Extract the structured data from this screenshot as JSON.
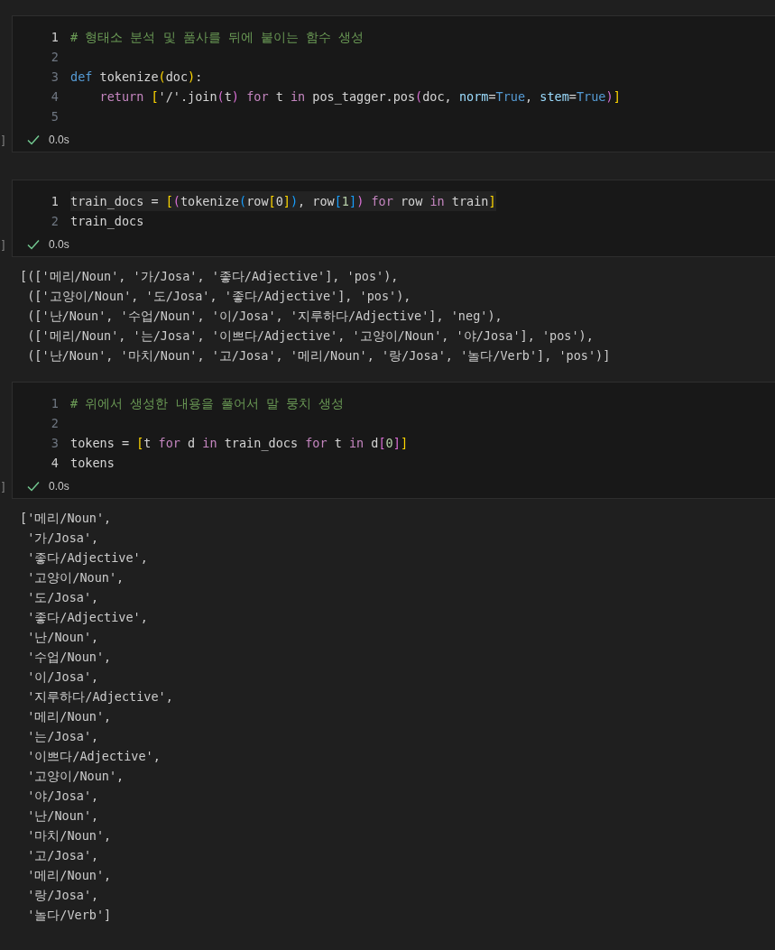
{
  "cells": [
    {
      "focused": false,
      "lines": [
        {
          "number": "1",
          "selected": true,
          "tokens": [
            {
              "kind": "comment",
              "text": "# 형태소 분석 및 품사를 뒤에 붙이는 함수 생성"
            }
          ]
        },
        {
          "number": "2",
          "selected": false
        },
        {
          "number": "3",
          "selected": false,
          "tokens": [
            {
              "kind": "keyword",
              "text": "def"
            },
            {
              "kind": "plain",
              "text": " tokenize"
            },
            {
              "kind": "b1",
              "text": "("
            },
            {
              "kind": "plain",
              "text": "doc"
            },
            {
              "kind": "b1",
              "text": ")"
            },
            {
              "kind": "plain",
              "text": ":"
            }
          ]
        },
        {
          "number": "4",
          "selected": false,
          "tokens": [
            {
              "kind": "control",
              "text": "    return "
            },
            {
              "kind": "b1",
              "text": "["
            },
            {
              "kind": "plain",
              "text": "'/'.join"
            },
            {
              "kind": "b2",
              "text": "("
            },
            {
              "kind": "plain",
              "text": "t"
            },
            {
              "kind": "b2",
              "text": ")"
            },
            {
              "kind": "control",
              "text": " for"
            },
            {
              "kind": "plain",
              "text": " t "
            },
            {
              "kind": "control",
              "text": "in"
            },
            {
              "kind": "plain",
              "text": " pos_tagger.pos"
            },
            {
              "kind": "b2",
              "text": "("
            },
            {
              "kind": "plain",
              "text": "doc, "
            },
            {
              "kind": "param",
              "text": "norm"
            },
            {
              "kind": "plain",
              "text": "="
            },
            {
              "kind": "keyword",
              "text": "True"
            },
            {
              "kind": "plain",
              "text": ", "
            },
            {
              "kind": "param",
              "text": "stem"
            },
            {
              "kind": "plain",
              "text": "="
            },
            {
              "kind": "keyword",
              "text": "True"
            },
            {
              "kind": "b2",
              "text": ")"
            },
            {
              "kind": "b1",
              "text": "]"
            }
          ]
        },
        {
          "number": "5",
          "selected": false
        }
      ],
      "status": {
        "bracket": "]",
        "time": "0.0s"
      }
    },
    {
      "focused": true,
      "lines": [
        {
          "number": "1",
          "selected": true,
          "tokens": [
            {
              "kind": "plain",
              "text": "train_docs = "
            },
            {
              "kind": "b1",
              "text": "["
            },
            {
              "kind": "b2",
              "text": "("
            },
            {
              "kind": "plain",
              "text": "tokenize"
            },
            {
              "kind": "b3",
              "text": "("
            },
            {
              "kind": "plain",
              "text": "row"
            },
            {
              "kind": "b1",
              "text": "["
            },
            {
              "kind": "plain",
              "text": "0"
            },
            {
              "kind": "b1",
              "text": "]"
            },
            {
              "kind": "b3",
              "text": ")"
            },
            {
              "kind": "plain",
              "text": ", row"
            },
            {
              "kind": "b3",
              "text": "["
            },
            {
              "kind": "number",
              "text": "1"
            },
            {
              "kind": "b3",
              "text": "]"
            },
            {
              "kind": "b2",
              "text": ")"
            },
            {
              "kind": "control",
              "text": " for"
            },
            {
              "kind": "plain",
              "text": " row "
            },
            {
              "kind": "control",
              "text": "in"
            },
            {
              "kind": "plain",
              "text": " train"
            },
            {
              "kind": "b1",
              "text": "]"
            }
          ]
        },
        {
          "number": "2",
          "selected": false,
          "tokens": [
            {
              "kind": "plain",
              "text": "train_docs"
            }
          ]
        }
      ],
      "status": {
        "bracket": "]",
        "time": "0.0s"
      },
      "output": [
        "[(['메리/Noun', '가/Josa', '좋다/Adjective'], 'pos'),",
        " (['고양이/Noun', '도/Josa', '좋다/Adjective'], 'pos'),",
        " (['난/Noun', '수업/Noun', '이/Josa', '지루하다/Adjective'], 'neg'),",
        " (['메리/Noun', '는/Josa', '이쁘다/Adjective', '고양이/Noun', '야/Josa'], 'pos'),",
        " (['난/Noun', '마치/Noun', '고/Josa', '메리/Noun', '랑/Josa', '놀다/Verb'], 'pos')]"
      ]
    },
    {
      "focused": false,
      "lines": [
        {
          "number": "1",
          "selected": false,
          "tokens": [
            {
              "kind": "comment",
              "text": "# 위에서 생성한 내용을 풀어서 말 뭉치 생성"
            }
          ]
        },
        {
          "number": "2",
          "selected": false
        },
        {
          "number": "3",
          "selected": false,
          "tokens": [
            {
              "kind": "plain",
              "text": "tokens = "
            },
            {
              "kind": "b1",
              "text": "["
            },
            {
              "kind": "plain",
              "text": "t "
            },
            {
              "kind": "control",
              "text": "for"
            },
            {
              "kind": "plain",
              "text": " d "
            },
            {
              "kind": "control",
              "text": "in"
            },
            {
              "kind": "plain",
              "text": " train_docs "
            },
            {
              "kind": "control",
              "text": "for"
            },
            {
              "kind": "plain",
              "text": " t "
            },
            {
              "kind": "control",
              "text": "in"
            },
            {
              "kind": "plain",
              "text": " d"
            },
            {
              "kind": "b2",
              "text": "["
            },
            {
              "kind": "number",
              "text": "0"
            },
            {
              "kind": "b2",
              "text": "]"
            },
            {
              "kind": "b1",
              "text": "]"
            }
          ]
        },
        {
          "number": "4",
          "selected": true,
          "tokens": [
            {
              "kind": "plain",
              "text": "tokens"
            }
          ]
        }
      ],
      "status": {
        "bracket": "]",
        "time": "0.0s"
      },
      "output": [
        "['메리/Noun',",
        " '가/Josa',",
        " '좋다/Adjective',",
        " '고양이/Noun',",
        " '도/Josa',",
        " '좋다/Adjective',",
        " '난/Noun',",
        " '수업/Noun',",
        " '이/Josa',",
        " '지루하다/Adjective',",
        " '메리/Noun',",
        " '는/Josa',",
        " '이쁘다/Adjective',",
        " '고양이/Noun',",
        " '야/Josa',",
        " '난/Noun',",
        " '마치/Noun',",
        " '고/Josa',",
        " '메리/Noun',",
        " '랑/Josa',",
        " '놀다/Verb']"
      ]
    }
  ]
}
